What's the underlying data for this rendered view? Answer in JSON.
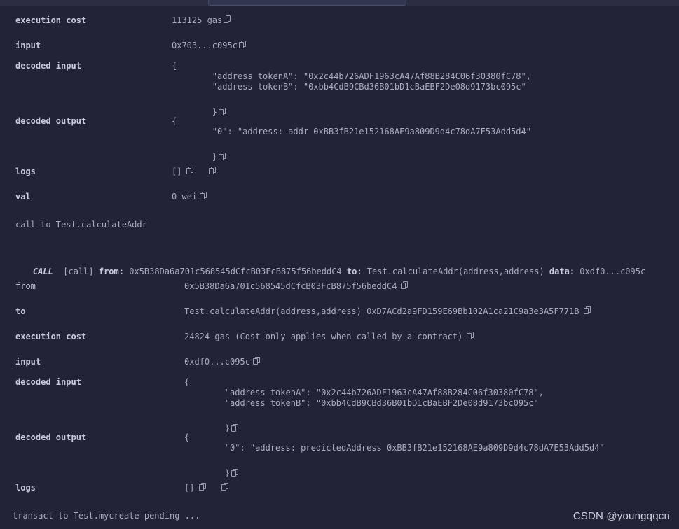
{
  "top_input": {
    "value": "",
    "placeholder": ""
  },
  "section_one": {
    "rows": [
      {
        "label": "execution cost",
        "value": "113125 gas",
        "copies": 1
      },
      {
        "label": "input",
        "value": "0x703...c095c",
        "copies": 1
      }
    ],
    "decoded_input": {
      "label": "decoded input",
      "open": "{",
      "lines": [
        "        \"address tokenA\": \"0x2c44b726ADF1963cA47Af88B284C06f30380fC78\",",
        "        \"address tokenB\": \"0xbb4CdB9CBd36B01bD1cBaEBF2De08d9173bc095c\""
      ],
      "close": "}",
      "copies": 1
    },
    "decoded_output": {
      "label": "decoded output",
      "open": "{",
      "lines": [
        "        \"0\": \"address: addr 0xBB3fB21e152168AE9a809D9d4c78dA7E53Add5d4\""
      ],
      "close": "}",
      "copies": 1
    },
    "logs": {
      "label": "logs",
      "value": "[]",
      "copies": 2
    },
    "val": {
      "label": "val",
      "value": "0 wei",
      "copies": 1
    },
    "call_note": "call to Test.calculateAddr"
  },
  "call_header": {
    "tag": "CALL",
    "bracket": "[call]",
    "from_label": "from:",
    "from_value": "0x5B38Da6a701c568545dCfcB03FcB875f56beddC4",
    "to_label": "to:",
    "to_value": "Test.calculateAddr(address,address)",
    "data_label": "data:",
    "data_value": "0xdf0...c095c"
  },
  "section_two": {
    "rows": [
      {
        "label": "from",
        "value": "0x5B38Da6a701c568545dCfcB03FcB875f56beddC4",
        "copies": 1
      },
      {
        "label": "to",
        "value": "Test.calculateAddr(address,address) 0xD7ACd2a9FD159E69Bb102A1ca21C9a3e3A5F771B",
        "copies": 1
      },
      {
        "label": "execution cost",
        "value": "24824 gas (Cost only applies when called by a contract)",
        "copies": 1
      },
      {
        "label": "input",
        "value": "0xdf0...c095c",
        "copies": 1
      }
    ],
    "decoded_input": {
      "label": "decoded input",
      "open": "{",
      "lines": [
        "        \"address tokenA\": \"0x2c44b726ADF1963cA47Af88B284C06f30380fC78\",",
        "        \"address tokenB\": \"0xbb4CdB9CBd36B01bD1cBaEBF2De08d9173bc095c\""
      ],
      "close": "}",
      "copies": 1
    },
    "decoded_output": {
      "label": "decoded output",
      "open": "{",
      "lines": [
        "        \"0\": \"address: predictedAddress 0xBB3fB21e152168AE9a809D9d4c78dA7E53Add5d4\""
      ],
      "close": "}",
      "copies": 1
    },
    "logs": {
      "label": "logs",
      "value": "[]",
      "copies": 2
    },
    "pending_note": "transact to Test.mycreate pending ..."
  },
  "watermark": "CSDN @youngqqcn",
  "colors": {
    "background": "#222336",
    "label": "#c8cade",
    "value": "#a9abc2",
    "topbar": "#2b2d42"
  }
}
